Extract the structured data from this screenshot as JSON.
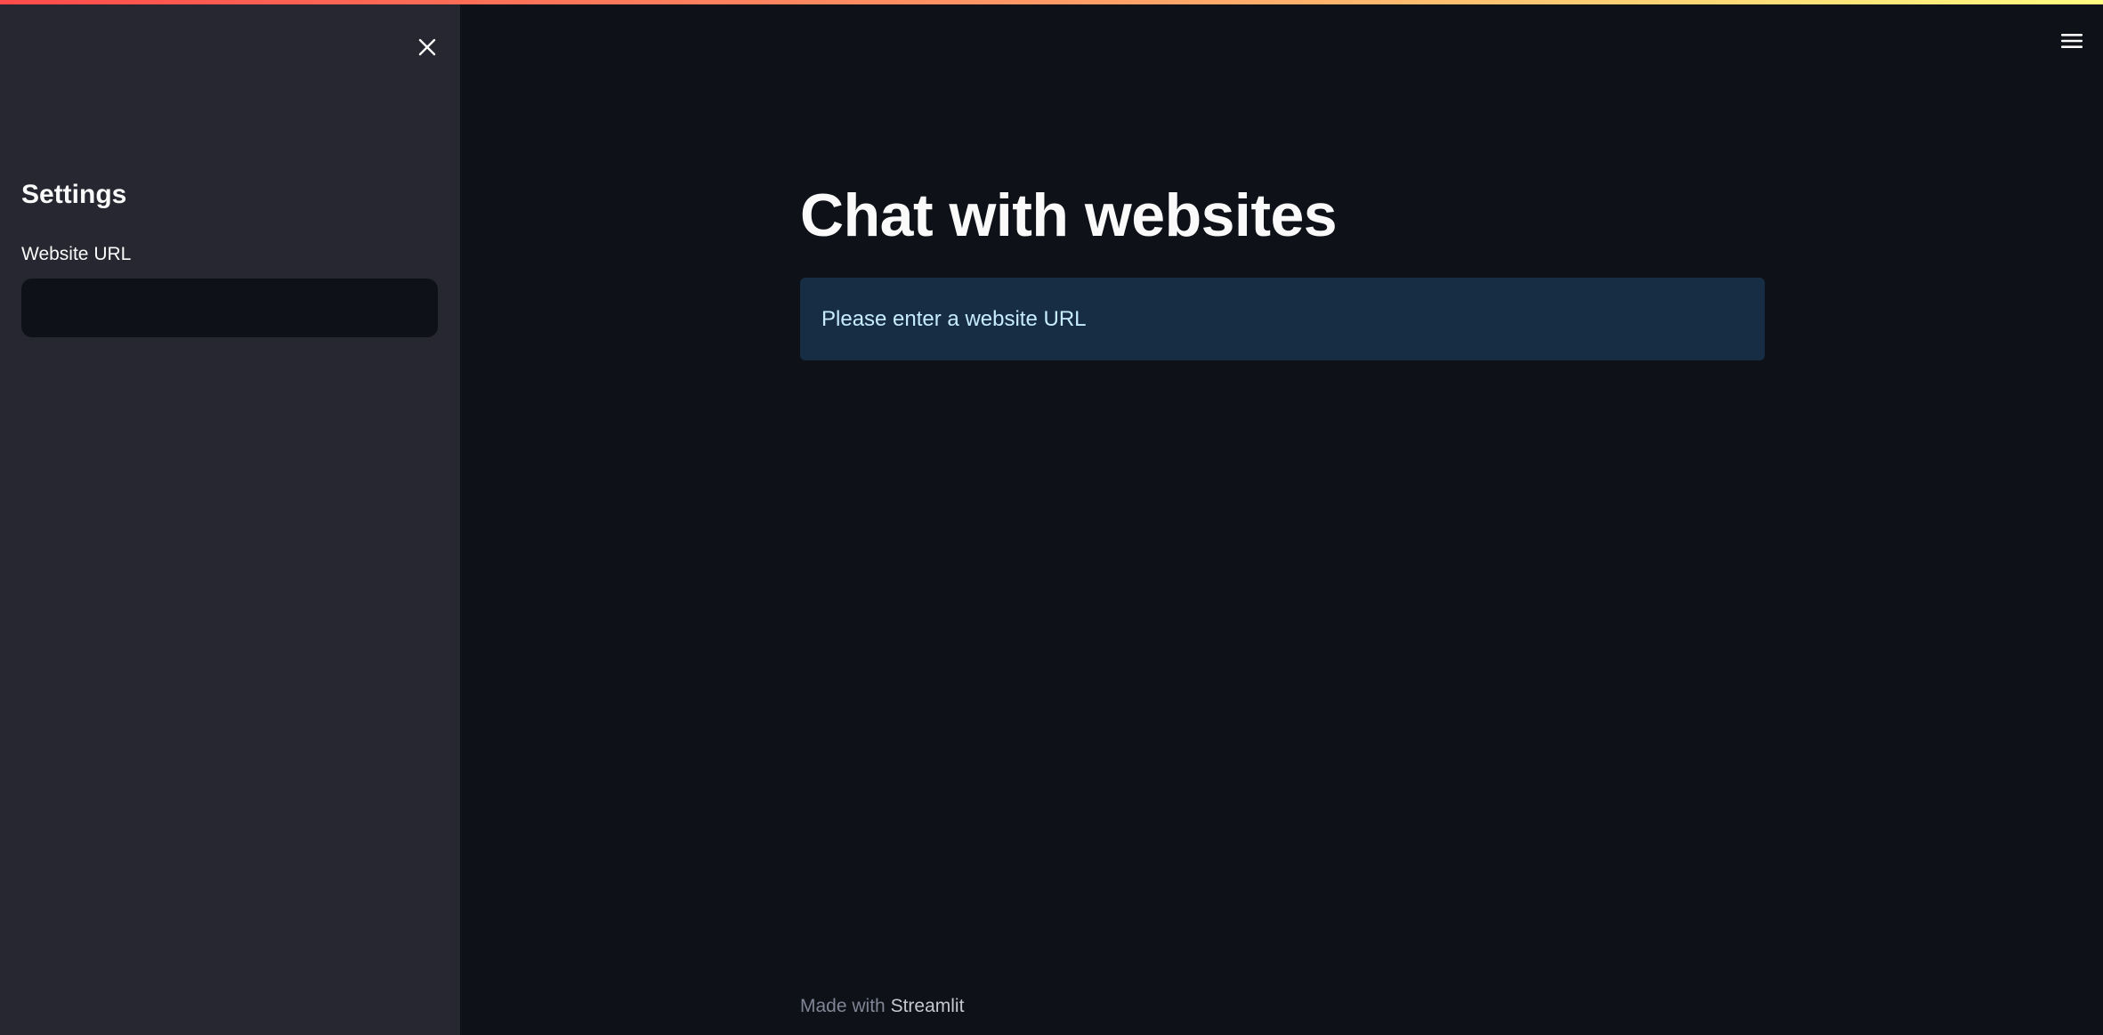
{
  "sidebar": {
    "title": "Settings",
    "url_field": {
      "label": "Website URL",
      "value": "",
      "placeholder": ""
    }
  },
  "main": {
    "title": "Chat with websites",
    "info_message": "Please enter a website URL"
  },
  "footer": {
    "made_with": "Made with",
    "brand": "Streamlit"
  },
  "icons": {
    "close": "close-icon",
    "menu": "hamburger-menu-icon"
  },
  "colors": {
    "background": "#0e1117",
    "sidebar_background": "#262730",
    "info_background": "#172d43",
    "info_text": "#c7ebff",
    "text": "#fafafa"
  }
}
